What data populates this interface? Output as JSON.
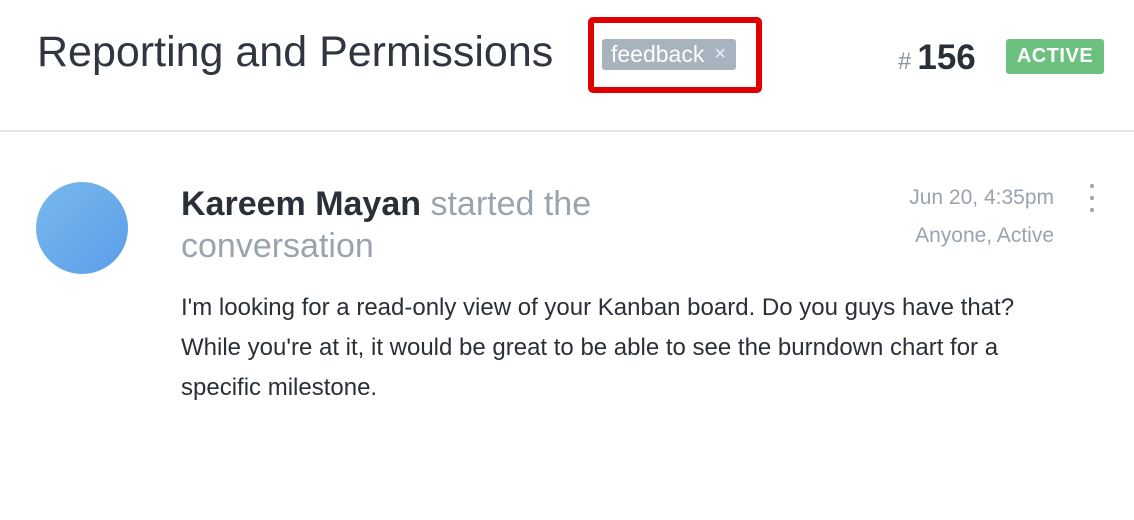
{
  "conversation": {
    "title": "Reporting and Permissions",
    "tag": {
      "label": "feedback",
      "remove_glyph": "×"
    },
    "issue_hash": "#",
    "issue_number": "156",
    "status": "ACTIVE",
    "status_color": "#6cc17f",
    "highlight_color": "#e00000"
  },
  "message": {
    "author": "Kareem Mayan",
    "action": "started the conversation",
    "timestamp": "Jun 20, 4:35pm",
    "visibility": "Anyone, Active",
    "more_icon": "vertical-ellipsis-icon",
    "body": "I'm looking for a read-only view of your Kanban board. Do you guys have that? While you're at it, it would be great to be able to see the burndown chart for a specific milestone."
  }
}
